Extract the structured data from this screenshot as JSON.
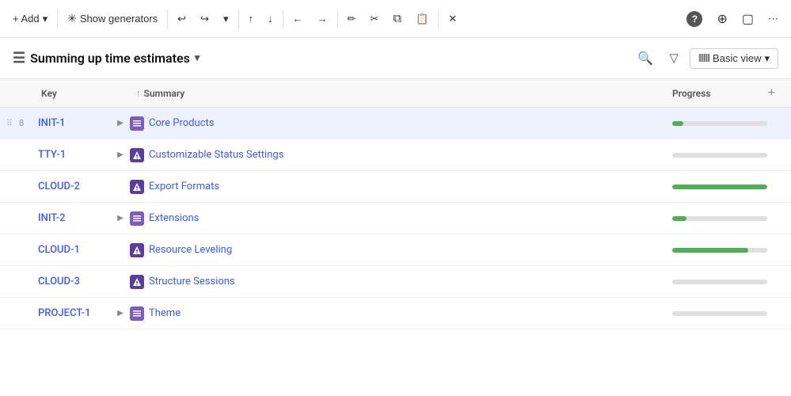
{
  "toolbar": {
    "add_label": "+ Add",
    "add_chevron": "▾",
    "generators_label": "Show generators",
    "generators_icon": "✳",
    "buttons": [
      {
        "name": "undo-left",
        "icon": "↖",
        "unicode": "↩"
      },
      {
        "name": "undo-right",
        "icon": "↗",
        "unicode": "↪"
      },
      {
        "name": "dropdown",
        "icon": "▾",
        "unicode": "▾"
      },
      {
        "name": "up",
        "icon": "↑",
        "unicode": "↑"
      },
      {
        "name": "down",
        "icon": "↓",
        "unicode": "↓"
      },
      {
        "name": "back",
        "icon": "←",
        "unicode": "←"
      },
      {
        "name": "forward",
        "icon": "→",
        "unicode": "→"
      },
      {
        "name": "edit",
        "icon": "✏",
        "unicode": "✏"
      },
      {
        "name": "cut",
        "icon": "✂",
        "unicode": "✂"
      },
      {
        "name": "copy",
        "icon": "⧉",
        "unicode": "⧉"
      },
      {
        "name": "paste",
        "icon": "📋",
        "unicode": "📋"
      },
      {
        "name": "close",
        "icon": "✕",
        "unicode": "✕"
      },
      {
        "name": "help",
        "icon": "?",
        "unicode": "?"
      },
      {
        "name": "circle-arrow",
        "icon": "⊕",
        "unicode": "⊕"
      },
      {
        "name": "expand",
        "icon": "▢",
        "unicode": "▢"
      },
      {
        "name": "more",
        "icon": "⋯",
        "unicode": "⋯"
      }
    ]
  },
  "header": {
    "list_icon": "≡",
    "title": "Summing up time estimates",
    "chevron": "▾",
    "search_icon": "🔍",
    "filter_icon": "▽",
    "view_icon": "|||",
    "view_label": "Basic view",
    "view_chevron": "▾"
  },
  "table": {
    "columns": {
      "key": "Key",
      "summary": "Summary",
      "summary_icon": "↑",
      "progress": "Progress"
    },
    "rows": [
      {
        "drag": "⠿",
        "number": "8",
        "key": "INIT-1",
        "expandable": true,
        "icon_type": "purple",
        "icon_char": "☰",
        "name": "Core Products",
        "progress": 12,
        "selected": true
      },
      {
        "drag": "",
        "number": "",
        "key": "TTY-1",
        "expandable": true,
        "icon_type": "dark-purple",
        "icon_char": "⚡",
        "name": "Customizable Status Settings",
        "progress": 0,
        "selected": false
      },
      {
        "drag": "",
        "number": "",
        "key": "CLOUD-2",
        "expandable": false,
        "icon_type": "dark-purple",
        "icon_char": "⚡",
        "name": "Export Formats",
        "progress": 100,
        "selected": false
      },
      {
        "drag": "",
        "number": "",
        "key": "INIT-2",
        "expandable": true,
        "icon_type": "purple",
        "icon_char": "☰",
        "name": "Extensions",
        "progress": 15,
        "selected": false
      },
      {
        "drag": "",
        "number": "",
        "key": "CLOUD-1",
        "expandable": false,
        "icon_type": "dark-purple",
        "icon_char": "⚡",
        "name": "Resource Leveling",
        "progress": 80,
        "selected": false
      },
      {
        "drag": "",
        "number": "",
        "key": "CLOUD-3",
        "expandable": false,
        "icon_type": "dark-purple",
        "icon_char": "⚡",
        "name": "Structure Sessions",
        "progress": 0,
        "selected": false
      },
      {
        "drag": "",
        "number": "",
        "key": "PROJECT-1",
        "expandable": true,
        "icon_type": "purple",
        "icon_char": "☰",
        "name": "Theme",
        "progress": 0,
        "selected": false
      }
    ]
  }
}
